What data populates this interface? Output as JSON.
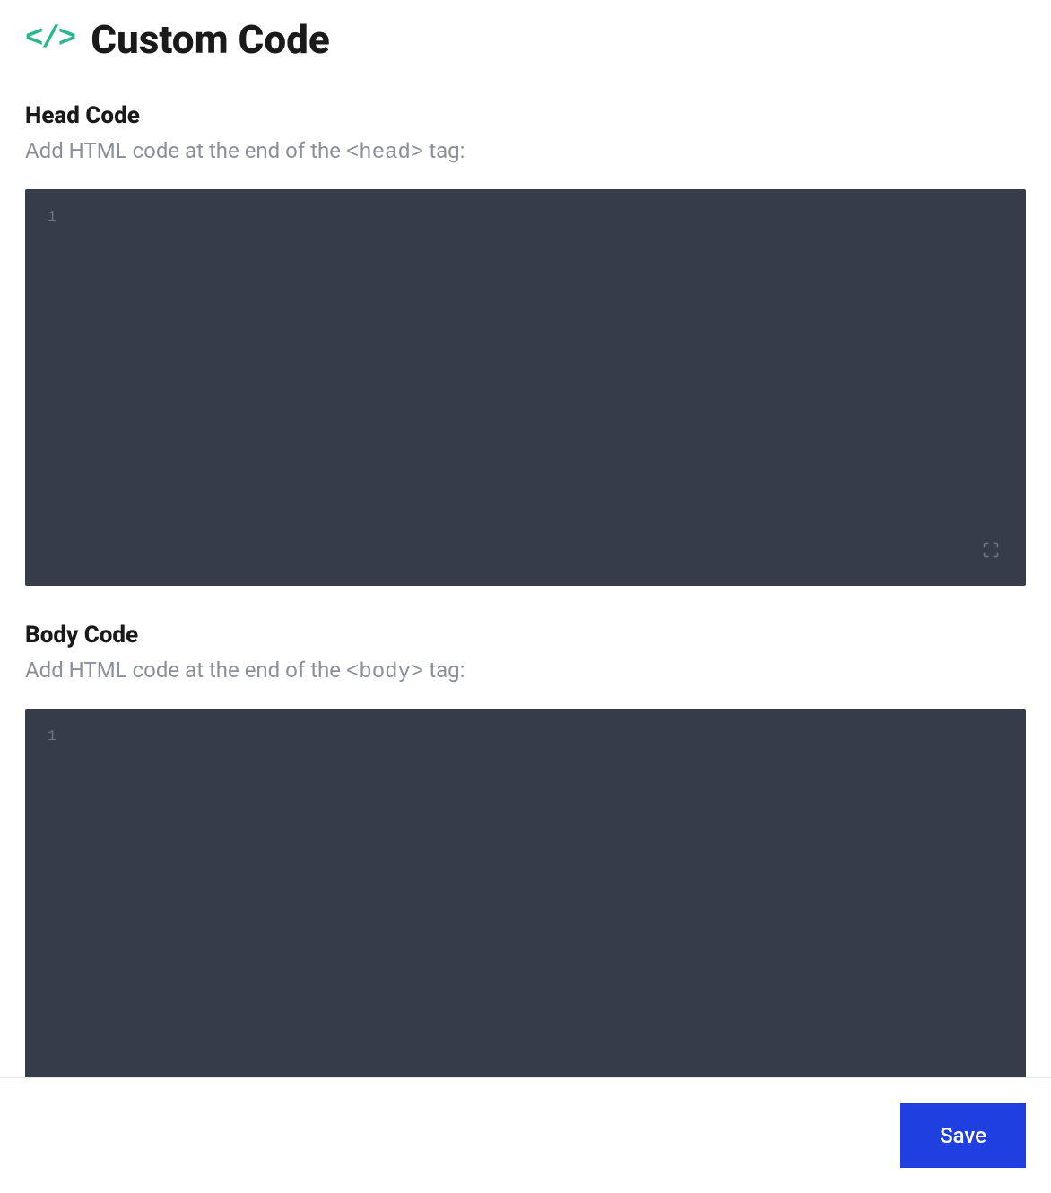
{
  "header": {
    "icon_text": "</>",
    "title": "Custom Code"
  },
  "sections": {
    "head": {
      "title": "Head Code",
      "description_pre": "Add HTML code at the end of the ",
      "description_code": "<head>",
      "description_post": " tag:",
      "line_number": "1",
      "value": ""
    },
    "body": {
      "title": "Body Code",
      "description_pre": "Add HTML code at the end of the ",
      "description_code": "<body>",
      "description_post": " tag:",
      "line_number": "1",
      "value": ""
    }
  },
  "footer": {
    "save_label": "Save"
  }
}
